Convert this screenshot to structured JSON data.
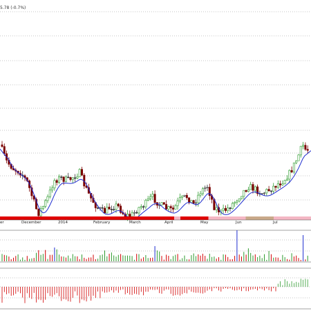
{
  "header": {
    "price_change": "5.78 (-0.7%)"
  },
  "colors": {
    "candle_up": "#2e9b2e",
    "candle_down": "#7a0000",
    "candle_neutral": "#333333",
    "moving_average": "#1e2dcf",
    "trend_red": "#e00000",
    "trend_pink": "#f4b7c4",
    "trend_tan": "#c9a98a",
    "volume_up": "#2e9b2e",
    "volume_down": "#d10000",
    "volume_spike": "#1e2dcf",
    "osc_negative": "#d10000",
    "osc_positive": "#2e9b2e",
    "grid": "#8a8a8a"
  },
  "chart_data": [
    {
      "type": "candlestick",
      "title": "",
      "x_labels": [
        "er",
        "December",
        "2014",
        "February",
        "March",
        "April",
        "May",
        "Jun",
        "Jul"
      ],
      "grid": true,
      "series": [
        {
          "name": "",
          "kind": "moving_average"
        }
      ],
      "trend_strip": [
        "red",
        "red",
        "red",
        "red",
        "red",
        "red",
        "red",
        "red",
        "red",
        "red",
        "red",
        "red",
        "red",
        "red",
        "red",
        "red",
        "red",
        "red",
        "red",
        "red",
        "red",
        "red",
        "red",
        "red",
        "red",
        "red",
        "red",
        "red",
        "red",
        "red",
        "red",
        "red",
        "red",
        "red",
        "red",
        "red",
        "red",
        "red",
        "red",
        "red",
        "red",
        "red",
        "red",
        "red",
        "red",
        "red",
        "red",
        "red",
        "red",
        "red",
        "red",
        "red",
        "red",
        "red",
        "red",
        "red",
        "pink",
        "pink",
        "red",
        "red",
        "red",
        "red",
        "red",
        "red",
        "red",
        "red",
        "red",
        "pink",
        "pink",
        "pink",
        "pink",
        "pink",
        "pink",
        "pink",
        "pink",
        "pink",
        "pink",
        "pink",
        "pink",
        "tan",
        "tan",
        "tan",
        "tan",
        "tan",
        "tan",
        "tan",
        "tan",
        "tan",
        "pink",
        "pink",
        "pink",
        "pink",
        "pink",
        "pink",
        "pink",
        "pink",
        "pink",
        "pink",
        "pink",
        "pink"
      ]
    },
    {
      "type": "bar",
      "title": "",
      "note_series": "volume"
    },
    {
      "type": "bar",
      "title": "",
      "note_series": "oscillator"
    }
  ],
  "months": [
    {
      "label": "er"
    },
    {
      "label": "December"
    },
    {
      "label": "2014"
    },
    {
      "label": "February"
    },
    {
      "label": "March"
    },
    {
      "label": "April"
    },
    {
      "label": "May"
    },
    {
      "label": "Jun"
    },
    {
      "label": "Jul"
    }
  ]
}
